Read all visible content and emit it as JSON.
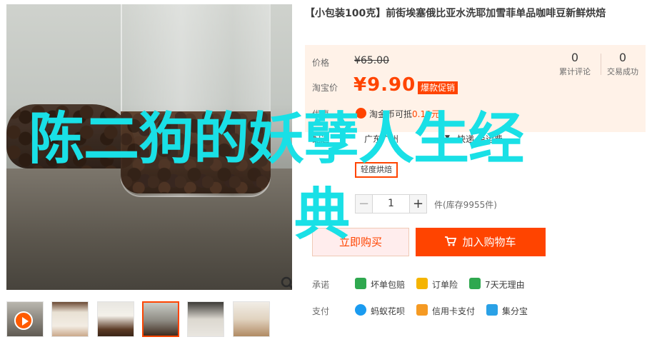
{
  "product": {
    "title": "【小包装100克】前街埃塞俄比亚水洗耶加雪菲单品咖啡豆新鲜烘焙"
  },
  "price_box": {
    "orig_label": "价格",
    "orig_price": "¥65.00",
    "cur_label": "淘宝价",
    "cur_price": "¥9.90",
    "promo_tag": "爆款促销",
    "coin_label": "优惠",
    "coin_text_prefix": "淘金币可抵",
    "coin_amount": "0.19元",
    "stats": [
      {
        "num": "0",
        "label": "累计评论"
      },
      {
        "num": "0",
        "label": "交易成功"
      }
    ]
  },
  "shipping": {
    "label": "配送",
    "dest": "广东广州",
    "dropdown_arrow": "▼",
    "fee": "快递 免运费"
  },
  "spec": {
    "tag_label": "轻度烘焙"
  },
  "quantity": {
    "minus": "−",
    "value": "1",
    "plus": "+",
    "stock": "件(库存9955件)"
  },
  "actions": {
    "buy_now": "立即购买",
    "add_to_cart": "加入购物车"
  },
  "promise": {
    "label": "承诺",
    "items": [
      {
        "text": "坏单包赔",
        "icon": "shield-check-icon",
        "color": "#2fa84f"
      },
      {
        "text": "订单险",
        "icon": "insurance-icon",
        "color": "#f5b400"
      },
      {
        "text": "7天无理由",
        "icon": "seven-days-icon",
        "color": "#2fa84f"
      }
    ]
  },
  "payment": {
    "label": "支付",
    "items": [
      {
        "text": "蚂蚁花呗",
        "icon": "huabei-icon",
        "color": "#1a9bf0"
      },
      {
        "text": "信用卡支付",
        "icon": "credit-card-icon",
        "color": "#f59a23"
      },
      {
        "text": "集分宝",
        "icon": "jifenbao-icon",
        "color": "#2aa1e6"
      }
    ]
  },
  "overlay": {
    "line1": "陈二狗的妖孽人生经",
    "line2": "典"
  },
  "colors": {
    "accent": "#ff4400",
    "overlay_text": "#19e0e6",
    "price_bg": "#fff2e8"
  }
}
